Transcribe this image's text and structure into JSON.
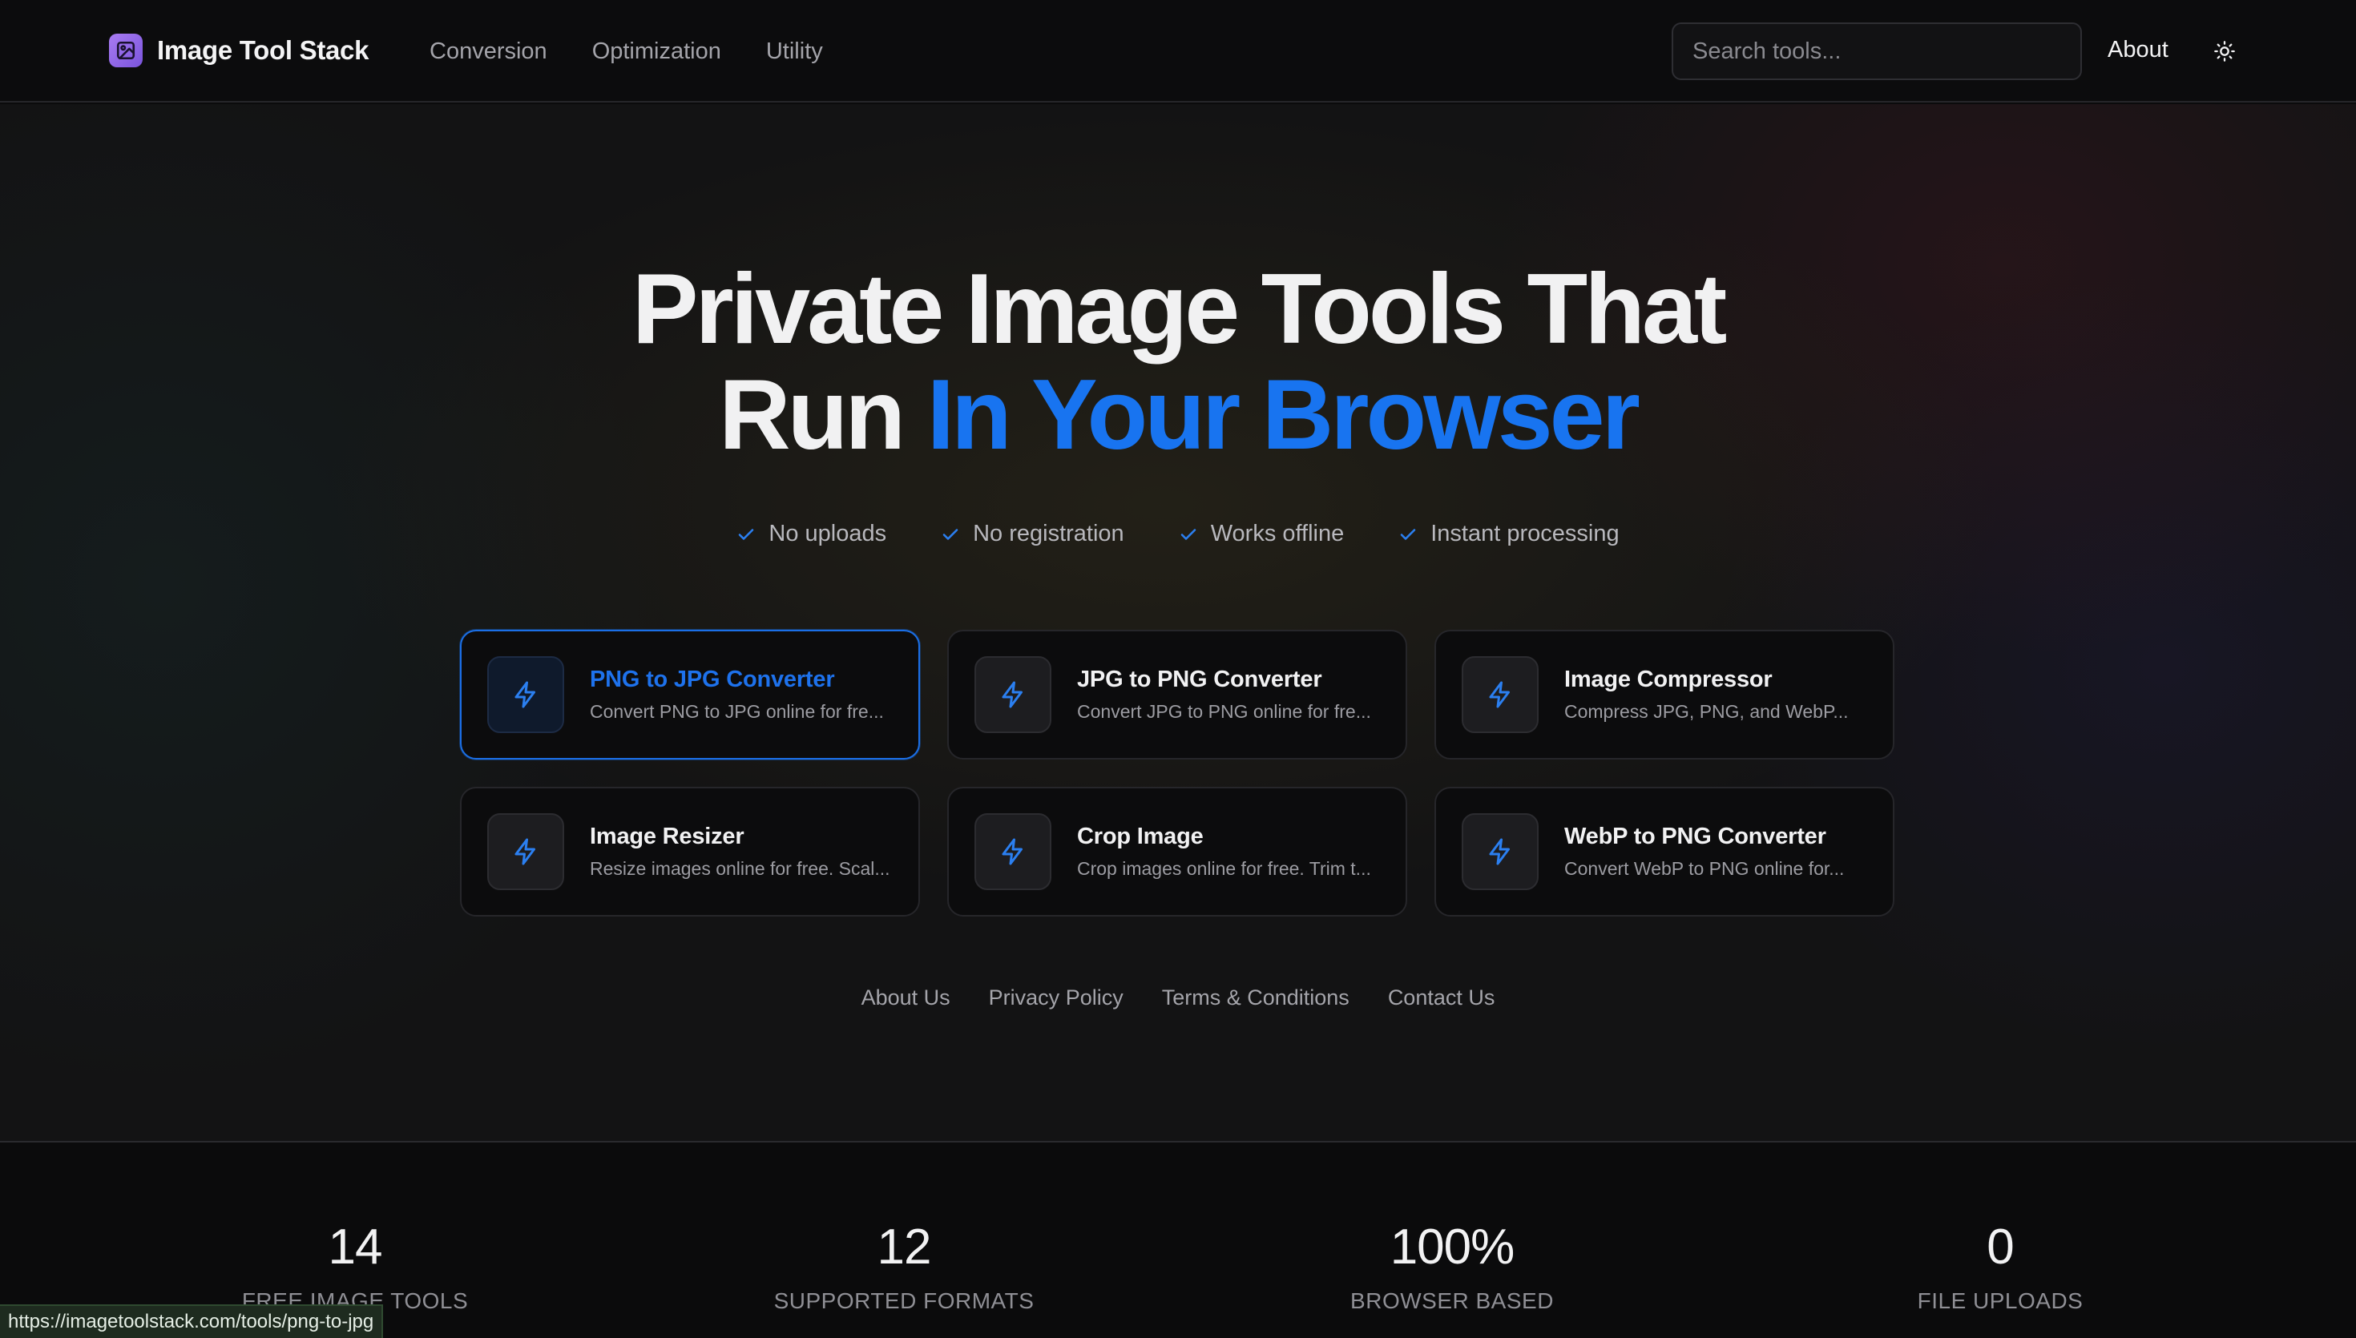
{
  "nav": {
    "brand": "Image Tool Stack",
    "links": [
      "Conversion",
      "Optimization",
      "Utility"
    ],
    "search_placeholder": "Search tools...",
    "about": "About"
  },
  "hero": {
    "title_line1": "Private Image Tools That",
    "title_line2_plain": "Run ",
    "title_line2_accent": "In Your Browser",
    "badges": [
      "No uploads",
      "No registration",
      "Works offline",
      "Instant processing"
    ],
    "tools": [
      {
        "title": "PNG to JPG Converter",
        "desc": "Convert PNG to JPG online for fre..."
      },
      {
        "title": "JPG to PNG Converter",
        "desc": "Convert JPG to PNG online for fre..."
      },
      {
        "title": "Image Compressor",
        "desc": "Compress JPG, PNG, and WebP..."
      },
      {
        "title": "Image Resizer",
        "desc": "Resize images online for free. Scal..."
      },
      {
        "title": "Crop Image",
        "desc": "Crop images online for free. Trim t..."
      },
      {
        "title": "WebP to PNG Converter",
        "desc": "Convert WebP to PNG online for..."
      }
    ]
  },
  "footer_links": [
    "About Us",
    "Privacy Policy",
    "Terms & Conditions",
    "Contact Us"
  ],
  "stats": [
    {
      "value": "14",
      "label": "FREE IMAGE TOOLS"
    },
    {
      "value": "12",
      "label": "SUPPORTED FORMATS"
    },
    {
      "value": "100%",
      "label": "BROWSER BASED"
    },
    {
      "value": "0",
      "label": "FILE UPLOADS"
    }
  ],
  "status_url": "https://imagetoolstack.com/tools/png-to-jpg",
  "colors": {
    "accent": "#1874f0",
    "brand_icon": "#8f66e6",
    "background": "#0b0b0c"
  }
}
